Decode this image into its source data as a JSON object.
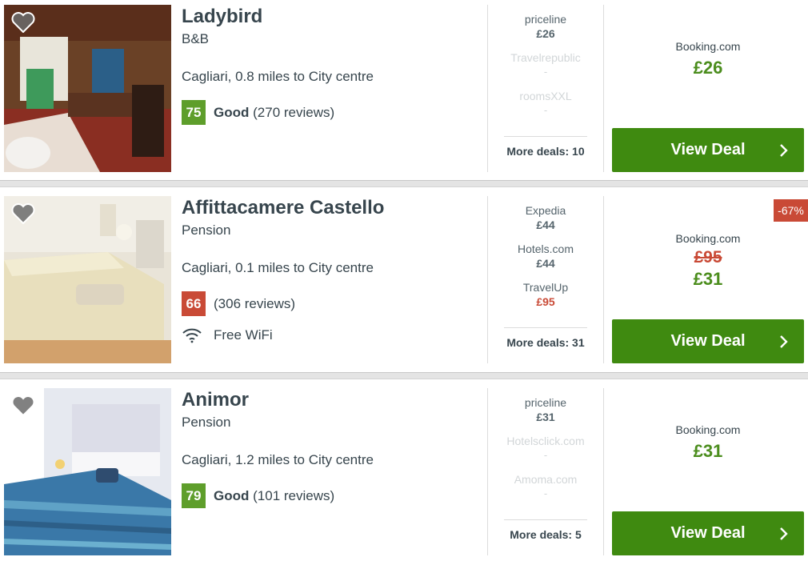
{
  "hotels": [
    {
      "name": "Ladybird",
      "type": "B&B",
      "location": "Cagliari, 0.8 miles to City centre",
      "rating": {
        "score": "75",
        "label": "Good",
        "reviews": "(270 reviews)",
        "color": "#5e9e2b"
      },
      "providers": [
        {
          "name": "priceline",
          "price": "£26"
        },
        {
          "name": "Travelrepublic",
          "price": "-"
        },
        {
          "name": "roomsXXL",
          "price": "-"
        }
      ],
      "more_deals": "More deals: 10",
      "deal": {
        "site": "Booking.com",
        "price": "£26"
      },
      "button": "View Deal"
    },
    {
      "name": "Affittacamere Castello",
      "type": "Pension",
      "location": "Cagliari, 0.1 miles to City centre",
      "rating": {
        "score": "66",
        "label": "",
        "reviews": "(306 reviews)",
        "color": "#c94a36"
      },
      "amenity": "Free WiFi",
      "providers": [
        {
          "name": "Expedia",
          "price": "£44"
        },
        {
          "name": "Hotels.com",
          "price": "£44"
        },
        {
          "name": "TravelUp",
          "price": "£95"
        }
      ],
      "more_deals": "More deals: 31",
      "discount": "-67%",
      "deal": {
        "site": "Booking.com",
        "old_price": "£95",
        "price": "£31"
      },
      "button": "View Deal"
    },
    {
      "name": "Animor",
      "type": "Pension",
      "location": "Cagliari, 1.2 miles to City centre",
      "rating": {
        "score": "79",
        "label": "Good",
        "reviews": "(101 reviews)",
        "color": "#5e9e2b"
      },
      "providers": [
        {
          "name": "priceline",
          "price": "£31"
        },
        {
          "name": "Hotelsclick.com",
          "price": "-"
        },
        {
          "name": "Amoma.com",
          "price": "-"
        }
      ],
      "more_deals": "More deals: 5",
      "deal": {
        "site": "Booking.com",
        "price": "£31"
      },
      "button": "View Deal"
    }
  ],
  "colors": {
    "button_green": "#3f8a10",
    "price_green": "#4b8d1d",
    "alert_red": "#c94a36"
  },
  "icons": {
    "favorite": "heart-icon",
    "wifi": "wifi-icon",
    "chevron": "chevron-right-icon"
  }
}
